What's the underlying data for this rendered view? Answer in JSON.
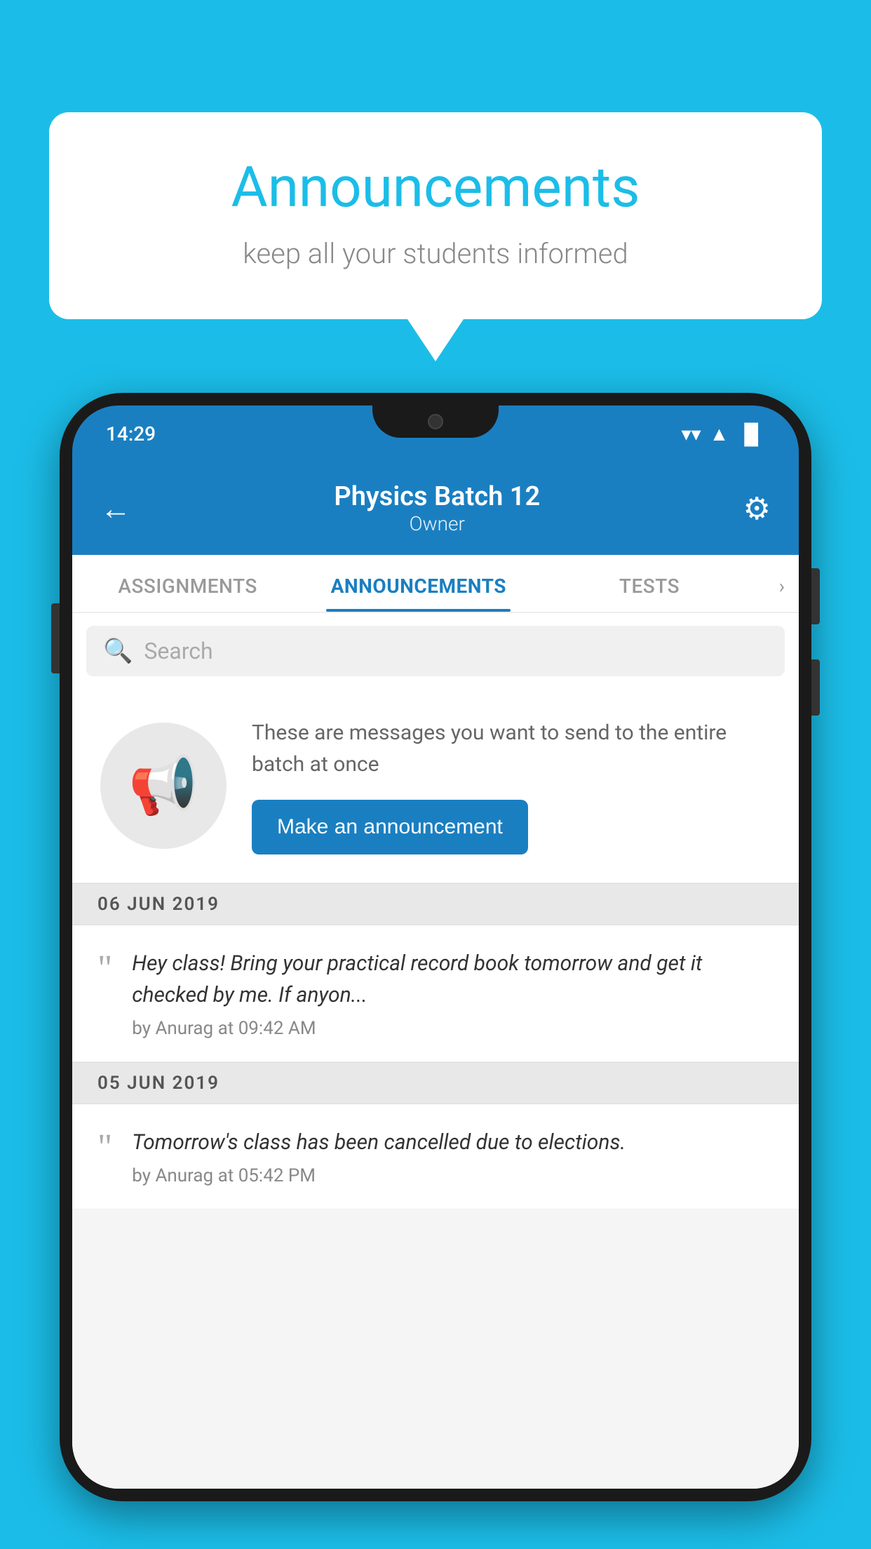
{
  "page": {
    "background_color": "#1BBDE8"
  },
  "speech_bubble": {
    "title": "Announcements",
    "subtitle": "keep all your students informed"
  },
  "phone": {
    "status_bar": {
      "time": "14:29",
      "wifi": "▼",
      "signal": "▲",
      "battery": "▐"
    },
    "header": {
      "back_label": "←",
      "title": "Physics Batch 12",
      "subtitle": "Owner",
      "settings_label": "⚙"
    },
    "tabs": [
      {
        "label": "ASSIGNMENTS",
        "active": false
      },
      {
        "label": "ANNOUNCEMENTS",
        "active": true
      },
      {
        "label": "TESTS",
        "active": false
      }
    ],
    "search": {
      "placeholder": "Search"
    },
    "announcement_prompt": {
      "description": "These are messages you want to send to the entire batch at once",
      "button_label": "Make an announcement"
    },
    "date_sections": [
      {
        "date": "06  JUN  2019",
        "items": [
          {
            "message": "Hey class! Bring your practical record book tomorrow and get it checked by me. If anyon...",
            "meta": "by Anurag at 09:42 AM"
          }
        ]
      },
      {
        "date": "05  JUN  2019",
        "items": [
          {
            "message": "Tomorrow's class has been cancelled due to elections.",
            "meta": "by Anurag at 05:42 PM"
          }
        ]
      }
    ]
  }
}
